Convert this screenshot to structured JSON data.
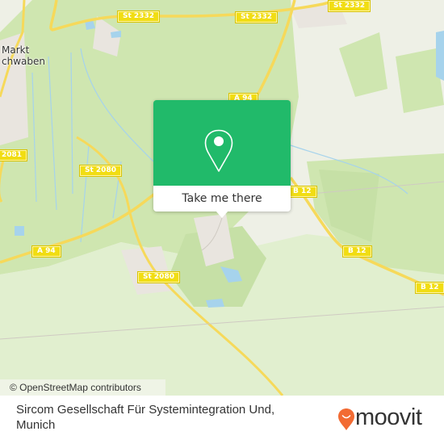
{
  "map": {
    "place_labels": [
      {
        "id": "markt-schwaben",
        "lines": [
          "Markt",
          "chwaben"
        ]
      }
    ],
    "road_labels": [
      {
        "id": "st2332-a",
        "text": "St 2332"
      },
      {
        "id": "st2332-b",
        "text": "St 2332"
      },
      {
        "id": "st2332-c",
        "text": "St 2332"
      },
      {
        "id": "a94-top",
        "text": "A 94"
      },
      {
        "id": "st2081",
        "text": "2081"
      },
      {
        "id": "st2080-a",
        "text": "St 2080"
      },
      {
        "id": "a94-left",
        "text": "A 94"
      },
      {
        "id": "st2080-b",
        "text": "St 2080"
      },
      {
        "id": "b12-a",
        "text": "B 12"
      },
      {
        "id": "b12-b",
        "text": "B 12"
      },
      {
        "id": "b12-c",
        "text": "B 12"
      }
    ],
    "colors": {
      "forest": "#cfe6b0",
      "forest_light": "#e1efcf",
      "residential": "#e9e5df",
      "water": "#a6d3ec",
      "road_major": "#f6d95a",
      "road_shield": "#f1dd13"
    }
  },
  "popup": {
    "icon": "map-pin-icon",
    "action_label": "Take me there",
    "color": "#21ba6a"
  },
  "attribution": "© OpenStreetMap contributors",
  "footer": {
    "place_name": "Sircom Gesellschaft Für Systemintegration Und, Munich"
  },
  "brand": {
    "name": "moovit",
    "logo_color": "#f26b33"
  }
}
